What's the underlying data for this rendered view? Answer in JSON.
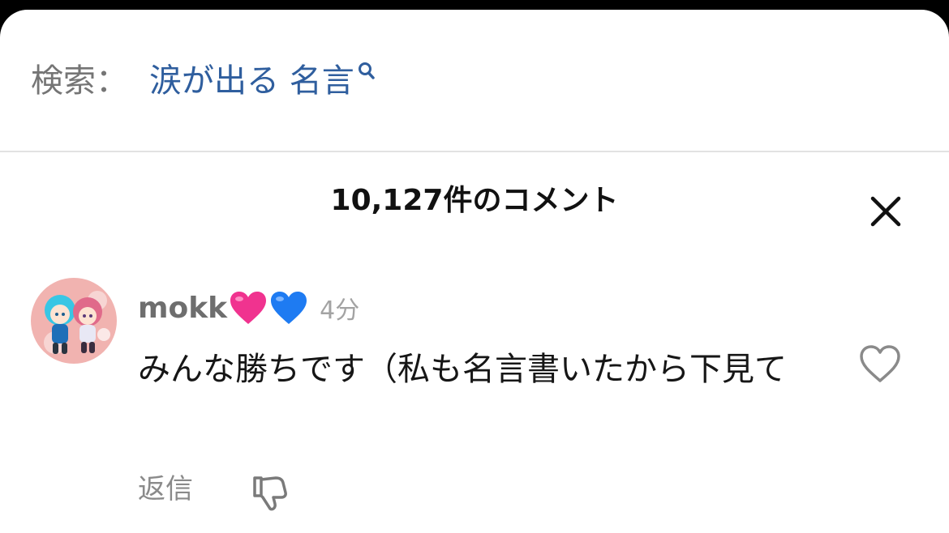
{
  "search": {
    "prefix": "検索：",
    "query": "涙が出る 名言",
    "icon": "search-icon"
  },
  "comments_panel": {
    "title": "10,127件のコメント",
    "close_icon": "close-icon"
  },
  "comment": {
    "username": "mokk",
    "emoji": [
      "pink-heart",
      "blue-heart"
    ],
    "time": "4分",
    "text": "みんな勝ちです（私も名言書いたから下見て",
    "reply_label": "返信",
    "like_icon": "heart-outline-icon",
    "dislike_icon": "thumbs-down-icon"
  },
  "colors": {
    "search_link": "#2f5e9e",
    "muted_text": "#757575",
    "pink_heart": "#f0338f",
    "blue_heart": "#1e7bf2"
  }
}
